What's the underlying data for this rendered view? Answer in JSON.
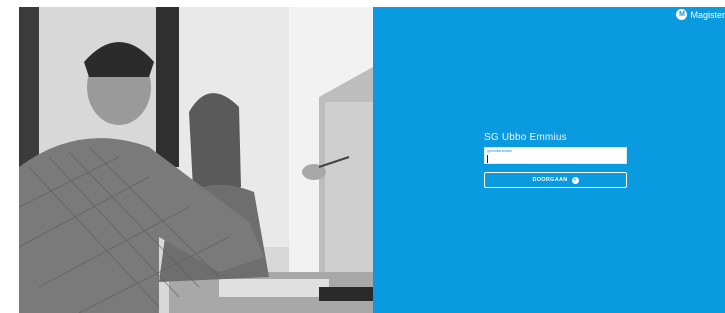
{
  "brand": {
    "name": "Magister",
    "logo_icon": "magister-logo-icon"
  },
  "login": {
    "school_name": "SG Ubbo Emmius",
    "username_label": "gebruikersnaam",
    "username_value": "",
    "continue_label": "DOORGAAN",
    "continue_icon": "arrow-right-circle-icon"
  },
  "colors": {
    "panel_background": "#0a9ae0",
    "text": "#ffffff"
  }
}
